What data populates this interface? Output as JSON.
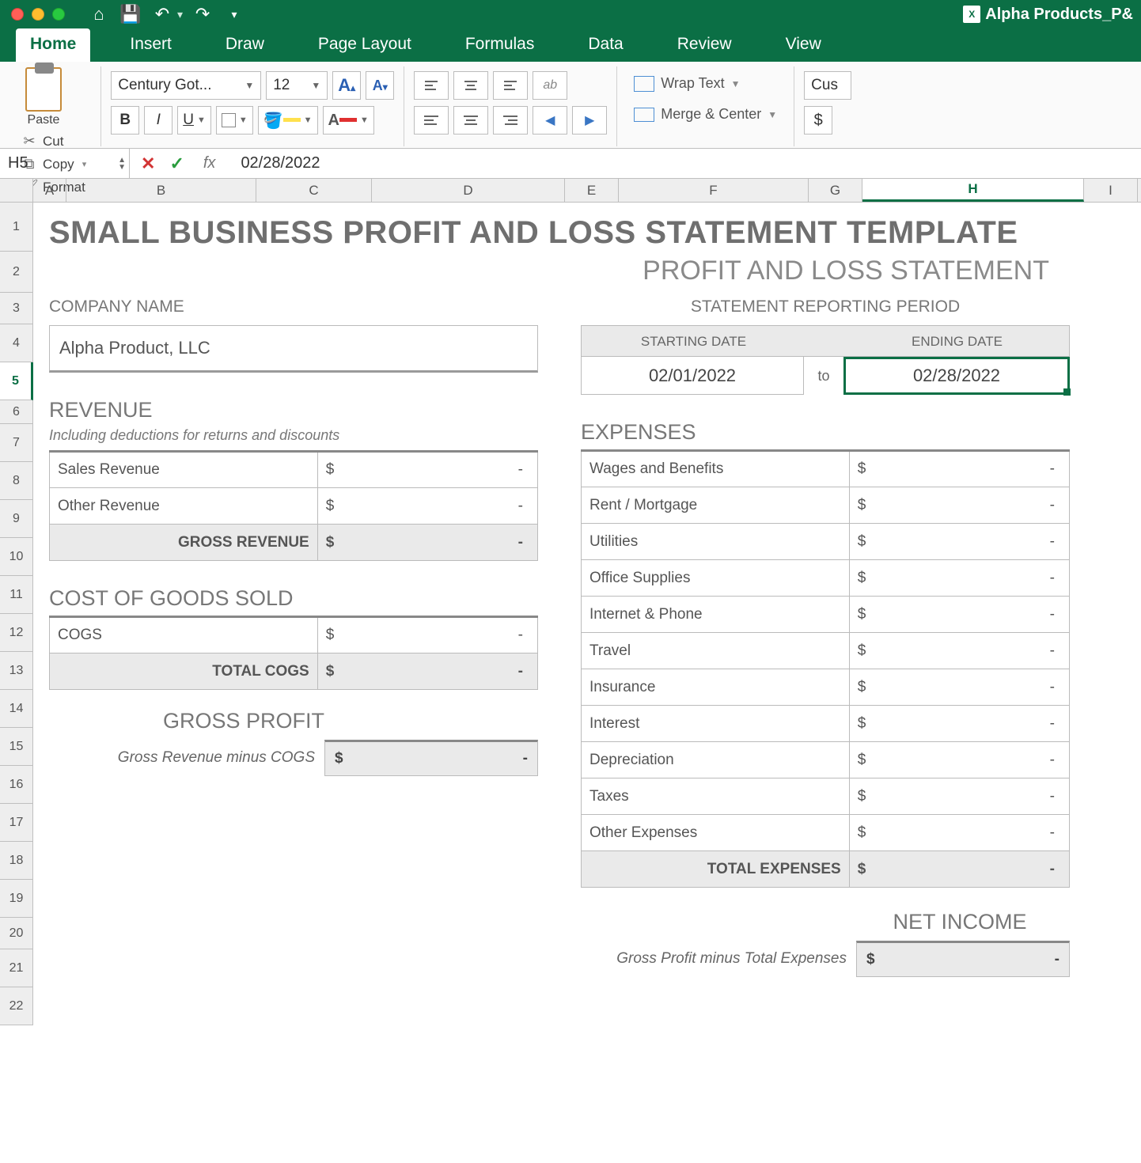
{
  "window": {
    "filename": "Alpha Products_P&"
  },
  "tabs": [
    "Home",
    "Insert",
    "Draw",
    "Page Layout",
    "Formulas",
    "Data",
    "Review",
    "View"
  ],
  "ribbon": {
    "paste": "Paste",
    "cut": "Cut",
    "copy": "Copy",
    "format": "Format",
    "font_name": "Century Got...",
    "font_size": "12",
    "wrap": "Wrap Text",
    "merge": "Merge & Center",
    "numfmt": "Cus"
  },
  "formula_bar": {
    "cell": "H5",
    "value": "02/28/2022"
  },
  "columns": [
    "A",
    "B",
    "C",
    "D",
    "E",
    "F",
    "G",
    "H",
    "I"
  ],
  "rows": [
    "1",
    "2",
    "3",
    "4",
    "5",
    "6",
    "7",
    "8",
    "9",
    "10",
    "11",
    "12",
    "13",
    "14",
    "15",
    "16",
    "17",
    "18",
    "19",
    "20",
    "21",
    "22"
  ],
  "sheet": {
    "title": "SMALL BUSINESS PROFIT AND LOSS STATEMENT TEMPLATE",
    "subtitle": "PROFIT AND LOSS STATEMENT",
    "company_label": "COMPANY NAME",
    "company_value": "Alpha Product, LLC",
    "period_label": "STATEMENT REPORTING PERIOD",
    "start_label": "STARTING DATE",
    "end_label": "ENDING DATE",
    "start_value": "02/01/2022",
    "to": "to",
    "end_value": "02/28/2022",
    "revenue_h": "REVENUE",
    "revenue_note": "Including deductions for returns and discounts",
    "rev_rows": [
      {
        "label": "Sales Revenue",
        "sym": "$",
        "val": "-"
      },
      {
        "label": "Other Revenue",
        "sym": "$",
        "val": "-"
      }
    ],
    "gross_rev_label": "GROSS REVENUE",
    "gross_rev_sym": "$",
    "gross_rev_val": "-",
    "cogs_h": "COST OF GOODS SOLD",
    "cogs_rows": [
      {
        "label": "COGS",
        "sym": "$",
        "val": "-"
      }
    ],
    "total_cogs_label": "TOTAL COGS",
    "total_cogs_sym": "$",
    "total_cogs_val": "-",
    "gp_h": "GROSS PROFIT",
    "gp_label": "Gross Revenue minus COGS",
    "gp_sym": "$",
    "gp_val": "-",
    "expenses_h": "EXPENSES",
    "exp_rows": [
      {
        "label": "Wages and Benefits",
        "sym": "$",
        "val": "-"
      },
      {
        "label": "Rent / Mortgage",
        "sym": "$",
        "val": "-"
      },
      {
        "label": "Utilities",
        "sym": "$",
        "val": "-"
      },
      {
        "label": "Office Supplies",
        "sym": "$",
        "val": "-"
      },
      {
        "label": "Internet & Phone",
        "sym": "$",
        "val": "-"
      },
      {
        "label": "Travel",
        "sym": "$",
        "val": "-"
      },
      {
        "label": "Insurance",
        "sym": "$",
        "val": "-"
      },
      {
        "label": "Interest",
        "sym": "$",
        "val": "-"
      },
      {
        "label": "Depreciation",
        "sym": "$",
        "val": "-"
      },
      {
        "label": "Taxes",
        "sym": "$",
        "val": "-"
      },
      {
        "label": "Other Expenses",
        "sym": "$",
        "val": "-"
      }
    ],
    "total_exp_label": "TOTAL EXPENSES",
    "total_exp_sym": "$",
    "total_exp_val": "-",
    "ni_h": "NET INCOME",
    "ni_label": "Gross Profit minus Total Expenses",
    "ni_sym": "$",
    "ni_val": "-"
  }
}
